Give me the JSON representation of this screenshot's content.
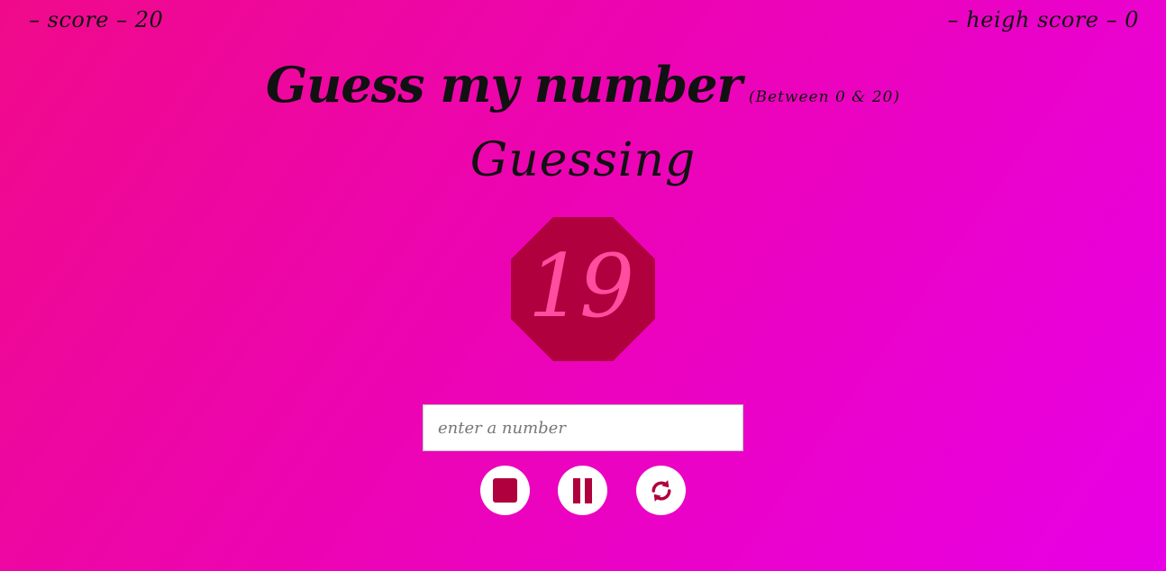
{
  "header": {
    "score_text": "–  score – 20",
    "highscore_text": "–  heigh score – 0"
  },
  "title": {
    "main": "Guess my number",
    "range": "(Between 0 & 20)"
  },
  "status": {
    "message": "Guessing"
  },
  "display": {
    "number": "19",
    "color": "#b0003e",
    "number_color": "#ff4da0"
  },
  "input": {
    "value": "",
    "placeholder": "enter a number"
  },
  "controls": [
    {
      "name": "stop",
      "icon": "stop-icon"
    },
    {
      "name": "pause",
      "icon": "pause-icon"
    },
    {
      "name": "restart",
      "icon": "refresh-icon"
    }
  ]
}
